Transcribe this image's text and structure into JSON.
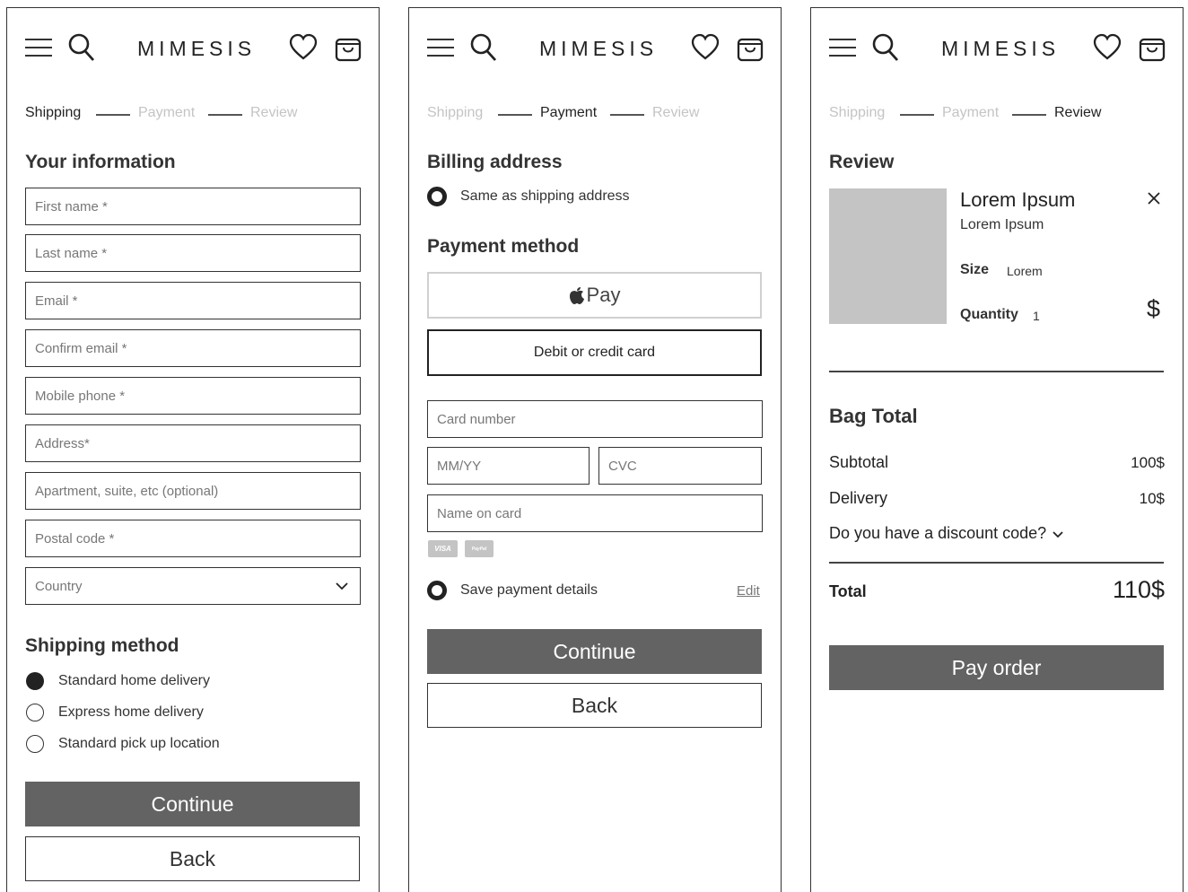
{
  "brand": "MIMESIS",
  "steps": [
    "Shipping",
    "Payment",
    "Review"
  ],
  "shipping": {
    "info_heading": "Your information",
    "fields": [
      "First name *",
      "Last name *",
      "Email *",
      "Confirm email *",
      "Mobile phone *",
      "Address*",
      "Apartment, suite, etc (optional)",
      "Postal code *"
    ],
    "country_placeholder": "Country",
    "method_heading": "Shipping method",
    "methods": [
      {
        "label": "Standard home delivery",
        "selected": true
      },
      {
        "label": "Express home delivery",
        "selected": false
      },
      {
        "label": "Standard pick up location",
        "selected": false
      }
    ],
    "continue_label": "Continue",
    "back_label": "Back"
  },
  "payment": {
    "billing_heading": "Billing address",
    "same_as_shipping": "Same as shipping address",
    "method_heading": "Payment method",
    "apple_pay_label": "Pay",
    "card_option_label": "Debit or credit card",
    "card_number": "Card number",
    "expiry": "MM/YY",
    "cvc": "CVC",
    "name_on_card": "Name on card",
    "card_logos": [
      "VISA",
      "PayPal"
    ],
    "save_details": "Save payment details",
    "edit_label": "Edit",
    "continue_label": "Continue",
    "back_label": "Back"
  },
  "review": {
    "heading": "Review",
    "product": {
      "title": "Lorem Ipsum",
      "subtitle": "Lorem Ipsum",
      "size_label": "Size",
      "size_value": "Lorem",
      "quantity_label": "Quantity",
      "quantity_value": "1",
      "price": "$"
    },
    "bag_total_heading": "Bag Total",
    "subtotal_label": "Subtotal",
    "subtotal_value": "100$",
    "delivery_label": "Delivery",
    "delivery_value": "10$",
    "discount_label": "Do you have a discount code?",
    "total_label": "Total",
    "total_value": "110$",
    "pay_label": "Pay order"
  },
  "colors": {
    "primary_button": "#636363",
    "inactive_step": "#c4c4c4",
    "placeholder_image": "#c4c4c4"
  }
}
